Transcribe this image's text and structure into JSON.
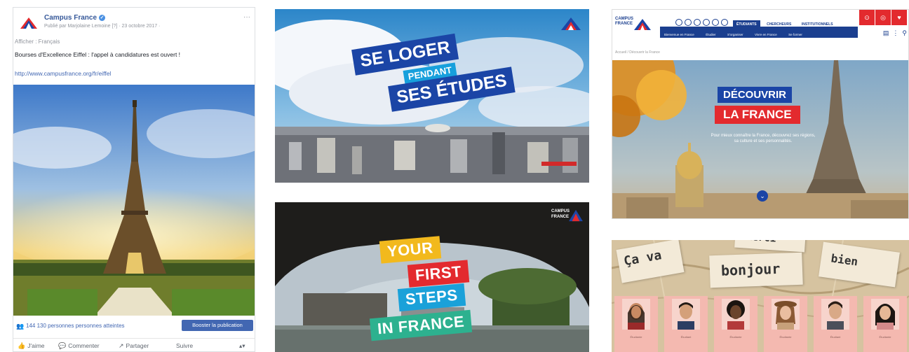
{
  "facebook_post": {
    "page_name": "Campus France",
    "meta": "Publié par Marjolaine Lemoine [?] · 23 octobre 2017 ·",
    "language": "Afficher : Français",
    "text": "Bourses d'Excellence Eiffel : l'appel à candidatures est ouvert !",
    "link": "http://www.campusfrance.org/fr/eiffel",
    "likes_count": "144 130 personnes",
    "likes_suffix": " personnes atteintes",
    "boost_label": "Booster la publication",
    "actions": {
      "like": "J'aime",
      "comment": "Commenter",
      "share": "Partager",
      "follow": "Suivre"
    }
  },
  "housing_banner": {
    "line1": "SE LOGER",
    "line2": "PENDANT",
    "line3": "SES ÉTUDES"
  },
  "first_steps_banner": {
    "logo_line1": "CAMPUS",
    "logo_line2": "FRANCE",
    "words": [
      "YOUR",
      "FIRST",
      "STEPS",
      "IN FRANCE"
    ]
  },
  "website": {
    "brand_line1": "CAMPUS",
    "brand_line2": "FRANCE",
    "tabs": [
      "ÉTUDIANTS",
      "CHERCHEURS",
      "INSTITUTIONNELS"
    ],
    "subnav": [
      "Bienvenue en France",
      "Étudier",
      "S'organiser",
      "Vivre en France",
      "Se former"
    ],
    "breadcrumb": "Accueil / Découvrir la France",
    "hero_title1": "DÉCOUVRIR",
    "hero_title2": "LA FRANCE",
    "hero_desc": "Pour mieux connaître la France, découvrez ses régions, sa culture et ses personnalités."
  },
  "language_panel": {
    "cards": [
      "Ça va",
      "bonjour",
      "bien",
      "merci"
    ],
    "people": [
      {
        "name": "Étudiante"
      },
      {
        "name": "Étudiant"
      },
      {
        "name": "Étudiante"
      },
      {
        "name": "Étudiante"
      },
      {
        "name": "Étudiant"
      },
      {
        "name": "Étudiante"
      }
    ]
  },
  "colors": {
    "brand_blue": "#1b45a6",
    "brand_red": "#e32a2e",
    "facebook_blue": "#4267b2"
  }
}
